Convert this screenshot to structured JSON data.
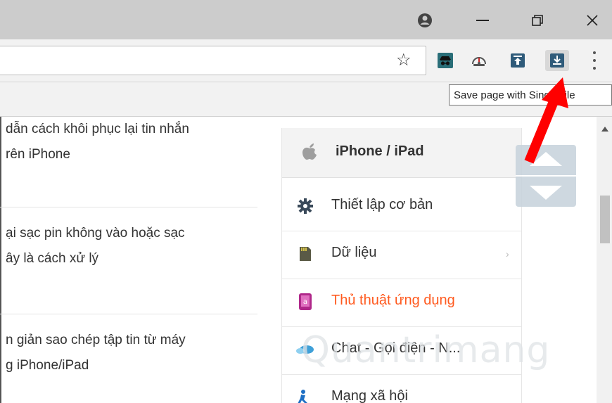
{
  "window": {
    "profile_icon": "account-circle-icon",
    "minimize_icon": "minimize-icon",
    "restore_icon": "restore-icon",
    "close_icon": "close-icon"
  },
  "toolbar": {
    "bookmark_icon": "star-icon",
    "extensions": [
      "incognito-extension-icon",
      "speedometer-extension-icon",
      "upload-extension-icon",
      "singlefile-save-icon"
    ],
    "menu_icon": "more-vertical-icon"
  },
  "tooltip": {
    "text": "Save page with SingleFile"
  },
  "articles": [
    {
      "line1": "dẫn cách khôi phục lại tin nhắn",
      "line2": "rên iPhone"
    },
    {
      "line1": "ại sạc pin không vào hoặc sạc",
      "line2": "ây là cách xử lý"
    },
    {
      "line1": "n giản sao chép tập tin từ máy",
      "line2": "g iPhone/iPad"
    }
  ],
  "menu": {
    "title": "iPhone / iPad",
    "items": [
      {
        "label": "Thiết lập cơ bản",
        "icon": "gear-icon",
        "color": "#333333"
      },
      {
        "label": "Dữ liệu",
        "icon": "sd-card-icon",
        "color": "#333333",
        "has_submenu": "›"
      },
      {
        "label": "Thủ thuật ứng dụng",
        "icon": "app-phone-icon",
        "color": "#ff5a1f"
      },
      {
        "label": "Chat - Gọi điện - N...",
        "icon": "chat-cloud-icon",
        "color": "#333333"
      },
      {
        "label": "Mạng xã hội",
        "icon": "social-network-icon",
        "color": "#333333"
      }
    ]
  },
  "watermark": "Quantrimang",
  "colors": {
    "accent": "#ff5a1f",
    "arrow": "#ff0000",
    "titlebar": "#cccccc"
  }
}
